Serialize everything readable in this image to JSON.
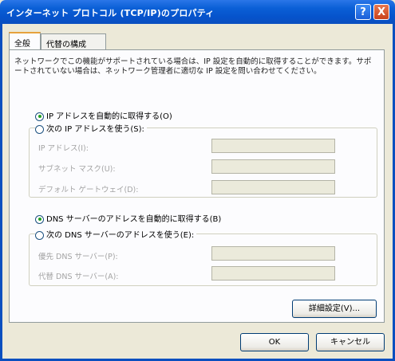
{
  "window": {
    "title": "インターネット プロトコル (TCP/IP)のプロパティ",
    "help_label": "?",
    "close_label": "X"
  },
  "tabs": [
    {
      "label": "全般",
      "active": true
    },
    {
      "label": "代替の構成",
      "active": false
    }
  ],
  "description": "ネットワークでこの機能がサポートされている場合は、IP 設定を自動的に取得することができます。サポートされていない場合は、ネットワーク管理者に適切な IP 設定を問い合わせてください。",
  "ip": {
    "auto_label": "IP アドレスを自動的に取得する(O)",
    "manual_label": "次の IP アドレスを使う(S):",
    "selected": "auto",
    "fields": [
      {
        "label": "IP アドレス(I):",
        "value": ""
      },
      {
        "label": "サブネット マスク(U):",
        "value": ""
      },
      {
        "label": "デフォルト ゲートウェイ(D):",
        "value": ""
      }
    ]
  },
  "dns": {
    "auto_label": "DNS サーバーのアドレスを自動的に取得する(B)",
    "manual_label": "次の DNS サーバーのアドレスを使う(E):",
    "selected": "auto",
    "fields": [
      {
        "label": "優先 DNS サーバー(P):",
        "value": ""
      },
      {
        "label": "代替 DNS サーバー(A):",
        "value": ""
      }
    ]
  },
  "buttons": {
    "advanced": "詳細設定(V)...",
    "ok": "OK",
    "cancel": "キャンセル"
  },
  "colors": {
    "titlebar": "#0a5fd6",
    "window_bg": "#ece9d8",
    "tab_accent": "#e6a23c",
    "radio_dot": "#21a121"
  }
}
